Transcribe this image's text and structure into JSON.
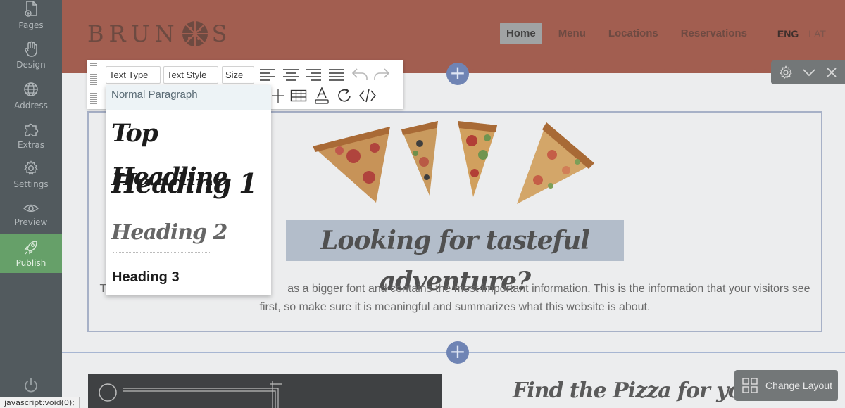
{
  "sidebar": {
    "items": [
      {
        "label": "Pages",
        "icon": "pages-icon"
      },
      {
        "label": "Design",
        "icon": "hand-icon"
      },
      {
        "label": "Address",
        "icon": "globe-icon"
      },
      {
        "label": "Extras",
        "icon": "puzzle-icon"
      },
      {
        "label": "Settings",
        "icon": "gear-icon"
      },
      {
        "label": "Preview",
        "icon": "eye-icon"
      },
      {
        "label": "Publish",
        "icon": "rocket-icon"
      }
    ],
    "active": "Publish",
    "power_icon": "power-icon"
  },
  "status_bar": {
    "url": "javascript:void(0);"
  },
  "site": {
    "logo": {
      "left": "BRUN",
      "right": "S",
      "mark": "pizza-logo-icon"
    },
    "nav": [
      "Home",
      "Menu",
      "Locations",
      "Reservations"
    ],
    "active_nav": "Home",
    "languages": [
      "ENG",
      "LAT"
    ],
    "headline": "Looking for tasteful adventure?",
    "body_line1": "Thi                                                       as a bigger font and contains the most important information. This is the information that your visitors see",
    "body_line2": "first, so make sure it is meaningful and summarizes what this website is about.",
    "subheading": "Find the Pizza for your taste",
    "change_layout": "Change Layout"
  },
  "toolbar": {
    "text_type": "Text Type",
    "text_style": "Text Style",
    "size": "Size",
    "icons": [
      "align-left-icon",
      "align-center-icon",
      "align-right-icon",
      "align-justify-icon",
      "undo-icon",
      "redo-icon",
      "insert-line-icon",
      "table-icon",
      "text-color-icon",
      "refresh-icon",
      "code-icon"
    ]
  },
  "dropdown": {
    "normal": "Normal Paragraph",
    "top": "Top Headline",
    "h1": "Heading 1",
    "h2": "Heading 2",
    "h3": "Heading 3"
  },
  "colors": {
    "sidebar": "#525a5e",
    "publish": "#66a069",
    "header": "#a25e50",
    "plus": "#6f84b4",
    "highlight": "#b3bdca"
  }
}
